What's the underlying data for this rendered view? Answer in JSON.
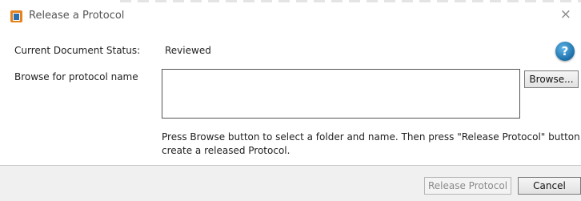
{
  "window": {
    "title": "Release a Protocol",
    "close_glyph": "×"
  },
  "help": {
    "glyph": "?"
  },
  "status": {
    "label": "Current Document Status:",
    "value": "Reviewed"
  },
  "browse": {
    "label": "Browse for protocol name",
    "field_value": "",
    "button_label": "Browse..."
  },
  "hint": "Press Browse button to select a folder and name. Then press \"Release Protocol\" button to create a released Protocol.",
  "footer": {
    "release_label": "Release Protocol",
    "cancel_label": "Cancel"
  }
}
